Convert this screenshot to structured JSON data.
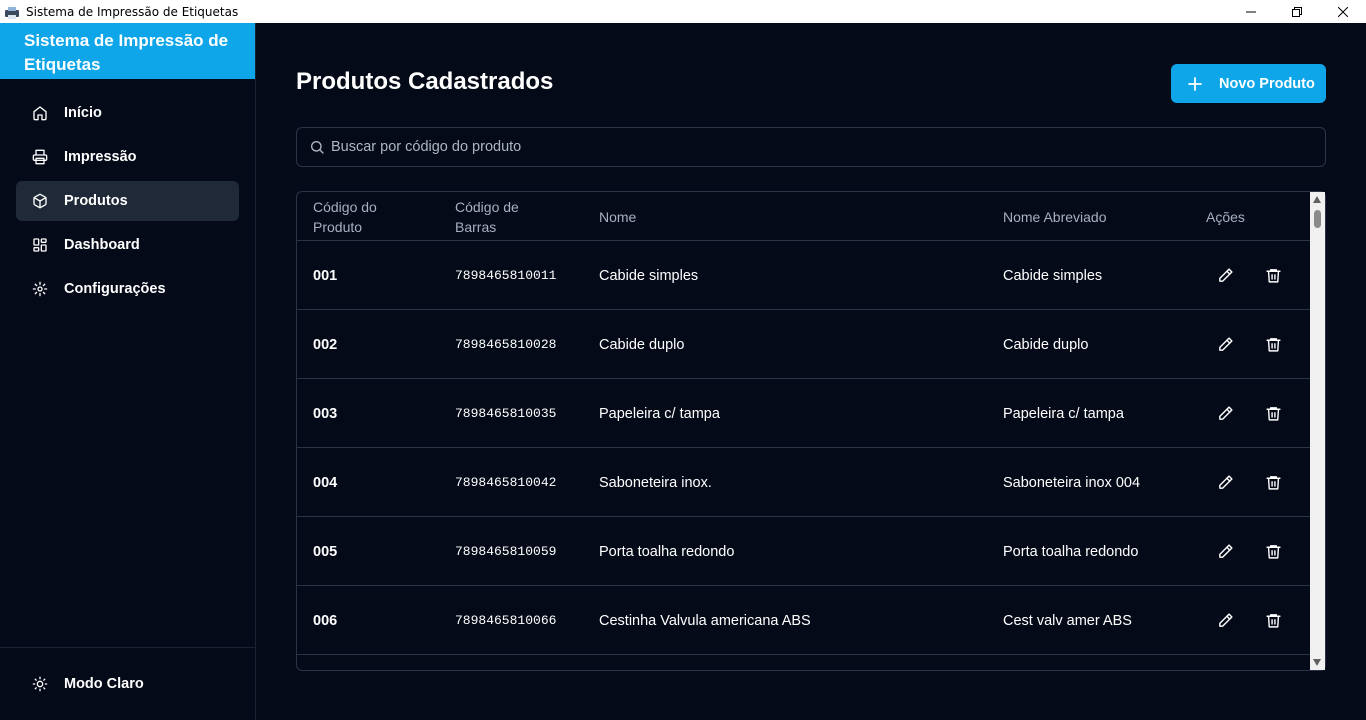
{
  "window": {
    "title": "Sistema de Impressão de Etiquetas"
  },
  "sidebar": {
    "brand": "Sistema de Impressão de Etiquetas",
    "items": [
      {
        "label": "Início",
        "icon": "home-icon"
      },
      {
        "label": "Impressão",
        "icon": "printer-icon"
      },
      {
        "label": "Produtos",
        "icon": "package-icon",
        "active": true
      },
      {
        "label": "Dashboard",
        "icon": "dashboard-icon"
      },
      {
        "label": "Configurações",
        "icon": "gear-icon"
      }
    ],
    "theme_toggle": "Modo Claro"
  },
  "main": {
    "title": "Produtos Cadastrados",
    "new_button": "Novo Produto",
    "search_placeholder": "Buscar por código do produto",
    "columns": {
      "code_line1": "Código do",
      "code_line2": "Produto",
      "barcode_line1": "Código de",
      "barcode_line2": "Barras",
      "name": "Nome",
      "short_name": "Nome Abreviado",
      "actions": "Ações"
    },
    "rows": [
      {
        "code": "001",
        "barcode": "7898465810011",
        "name": "Cabide simples",
        "short": "Cabide simples"
      },
      {
        "code": "002",
        "barcode": "7898465810028",
        "name": "Cabide duplo",
        "short": "Cabide duplo"
      },
      {
        "code": "003",
        "barcode": "7898465810035",
        "name": "Papeleira c/ tampa",
        "short": "Papeleira c/ tampa"
      },
      {
        "code": "004",
        "barcode": "7898465810042",
        "name": "Saboneteira inox.",
        "short": "Saboneteira inox 004"
      },
      {
        "code": "005",
        "barcode": "7898465810059",
        "name": "Porta toalha redondo",
        "short": "Porta toalha redondo"
      },
      {
        "code": "006",
        "barcode": "7898465810066",
        "name": "Cestinha Valvula americana ABS",
        "short": "Cest valv amer ABS"
      }
    ]
  },
  "colors": {
    "background": "#050a18",
    "accent": "#0ea5e9",
    "active_nav": "#1f2937",
    "border": "#2b3446"
  }
}
